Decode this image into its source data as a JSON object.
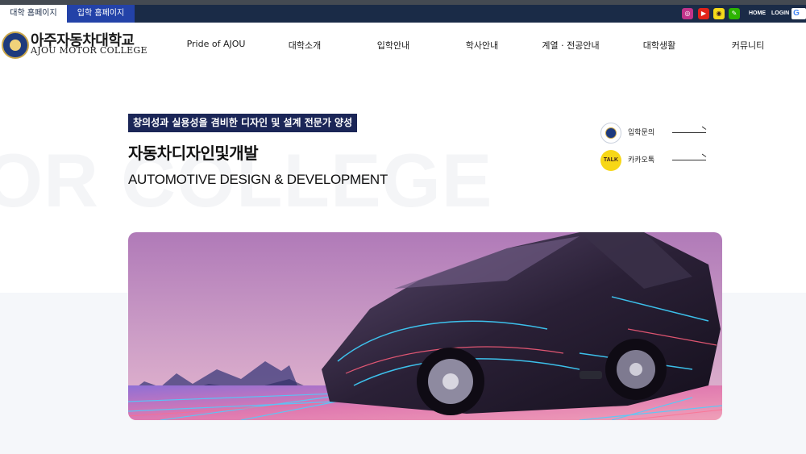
{
  "topbar": {
    "tabs": [
      {
        "label": "대학 홈페이지",
        "active": true
      },
      {
        "label": "입학 홈페이지",
        "active": false
      }
    ],
    "sns": [
      {
        "icon": "instagram-icon",
        "glyph": "◎",
        "color": "#c1338a"
      },
      {
        "icon": "youtube-icon",
        "glyph": "▶",
        "color": "#e2231a"
      },
      {
        "icon": "kakaotalk-icon",
        "glyph": "◉",
        "color": "#f5d91a"
      },
      {
        "icon": "blog-icon",
        "glyph": "✎",
        "color": "#2db400"
      }
    ],
    "home_label": "HOME",
    "login_label": "LOGIN",
    "google_glyph": "G"
  },
  "header": {
    "logo_ko": "아주자동차대학교",
    "logo_en": "AJOU MOTOR COLLEGE",
    "nav": [
      "Pride of AJOU",
      "대학소개",
      "입학안내",
      "학사안내",
      "계열 · 전공안내",
      "대학생활",
      "커뮤니티"
    ]
  },
  "hero": {
    "watermark": "OR COLLEGE",
    "tagline": "창의성과 실용성을 겸비한 디자인 및 설계 전문가 양성",
    "dept_ko": "자동차디자인및개발",
    "dept_en": "AUTOMOTIVE DESIGN & DEVELOPMENT"
  },
  "quick_links": [
    {
      "label": "입학문의",
      "icon": "emblem-icon"
    },
    {
      "label": "카카오톡",
      "icon": "kakaotalk-talk-icon",
      "glyph": "TALK"
    }
  ],
  "colors": {
    "topbar": "#1a2b47",
    "tab_active_bg": "#ffffff",
    "tab_inactive_bg": "#2342a8",
    "tagline_bg": "#1b2657",
    "kakao": "#f7d716"
  }
}
